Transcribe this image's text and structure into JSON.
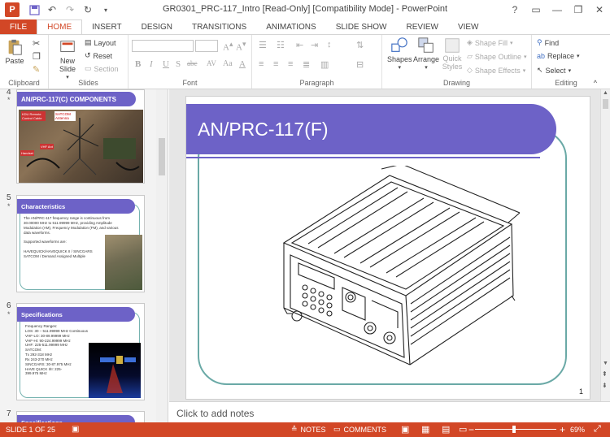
{
  "window": {
    "title": "GR0301_PRC-117_Intro [Read-Only] [Compatibility Mode] - PowerPoint",
    "app_logo": "P",
    "controls": {
      "help": "?",
      "minimize": "—",
      "restore": "❐",
      "close": "✕"
    }
  },
  "quick_access": {
    "icons": [
      "save-icon",
      "undo-icon",
      "redo-icon",
      "repeat-icon",
      "customize-icon"
    ]
  },
  "tabs": [
    {
      "label": "FILE"
    },
    {
      "label": "HOME"
    },
    {
      "label": "INSERT"
    },
    {
      "label": "DESIGN"
    },
    {
      "label": "TRANSITIONS"
    },
    {
      "label": "ANIMATIONS"
    },
    {
      "label": "SLIDE SHOW"
    },
    {
      "label": "REVIEW"
    },
    {
      "label": "VIEW"
    }
  ],
  "active_tab": "HOME",
  "ribbon": {
    "clipboard": {
      "label": "Clipboard",
      "paste": "Paste"
    },
    "slides": {
      "label": "Slides",
      "new_slide": "New Slide",
      "new_slide_arrow": "▾",
      "layout": "Layout",
      "reset": "Reset",
      "section": "Section"
    },
    "font": {
      "label": "Font",
      "buttons": [
        "B",
        "I",
        "U",
        "S",
        "abc",
        "AV",
        "Aa",
        "A"
      ]
    },
    "paragraph": {
      "label": "Paragraph"
    },
    "drawing": {
      "label": "Drawing",
      "shapes": "Shapes",
      "arrange": "Arrange",
      "quick_styles": "Quick Styles",
      "shape_fill": "Shape Fill",
      "shape_outline": "Shape Outline",
      "shape_effects": "Shape Effects"
    },
    "editing": {
      "label": "Editing",
      "find": "Find",
      "replace": "Replace",
      "select": "Select"
    },
    "collapse": "^"
  },
  "thumbnails": [
    {
      "number": "4",
      "star": "*",
      "title": "AN/PRC-117(C) COMPONENTS",
      "labels": [
        "KDU Remote Control Cable",
        "SATCOM Antenna",
        "Handset",
        "VHF Ant"
      ]
    },
    {
      "number": "5",
      "star": "*",
      "title": "Characteristics",
      "body": "The AN/PRC-117 frequency range is continuous from 30.00000 MHz to 511.99999 MHz, providing Amplitude Modulation (AM), Frequency Modulation (FM), and various data waveforms.\n\nSupported waveforms are:\n\nHAVEQUICK/HAVEQUICK II / SINCGARS\nSATCOM / Demand Assigned Multiple"
    },
    {
      "number": "6",
      "star": "*",
      "title": "Specifications",
      "body": "Frequency Ranges:\n  LOS:  30 – 511.99999 MHz Continuous\n    VHF-LO:  30-89.99999 MHz\n    VHF-HI:  90-224.99999 MHz\n    UHF:  225-511.99999 MHz\nSATCOM:\n    Tx 292-318 MHz\n    Rx 243-270 MHz\nSINCGARS:  30-87.975 MHz\nHAVE QUICK I/II:  225-\n399.975 MHz"
    },
    {
      "number": "7",
      "star": "",
      "title": "Specifications"
    }
  ],
  "slide": {
    "title": "AN/PRC-117(F)",
    "number": "1"
  },
  "notes": {
    "placeholder": "Click to add notes"
  },
  "status": {
    "slide_info": "SLIDE 1 OF 25",
    "notes": "NOTES",
    "comments": "COMMENTS",
    "zoom": "69%",
    "zoom_minus": "−",
    "zoom_plus": "+"
  },
  "colors": {
    "accent": "#d24726",
    "slide_title_bg": "#6d62c7",
    "frame": "#6aa9a6"
  }
}
